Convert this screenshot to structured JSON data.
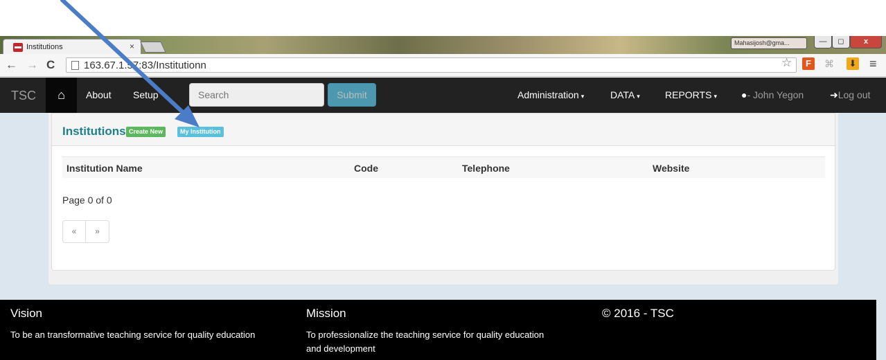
{
  "browser": {
    "tab_title": "Institutions",
    "tab_close": "×",
    "user_badge": "Mahasijosh@gma...",
    "url": "163.67.1.57:83/Institutionn",
    "back_icon": "←",
    "forward_icon": "→",
    "reload_icon": "C",
    "star_icon": "☆",
    "ext_f": "F",
    "ext_dl": "⬇",
    "menu_icon": "≡",
    "min_icon": "—",
    "max_icon": "◻",
    "close_icon": "x"
  },
  "navbar": {
    "brand": "TSC",
    "home_icon": "⌂",
    "about": "About",
    "setup": "Setup",
    "search_placeholder": "Search",
    "submit": "Submit",
    "administration": "Administration",
    "data": "DATA",
    "reports": "REPORTS",
    "user": "- John Yegon",
    "logout": "Log out",
    "caret": "▾"
  },
  "panel": {
    "title": "Institutions",
    "create_new": "Create New",
    "my_institution": "My Institution"
  },
  "table": {
    "headers": [
      "Institution Name",
      "Code",
      "Telephone",
      "Website"
    ]
  },
  "pagination": {
    "info": "Page 0 of 0",
    "prev": "«",
    "next": "»"
  },
  "footer": {
    "vision_title": "Vision",
    "vision_text": "To be an transformative teaching service for quality education",
    "mission_title": "Mission",
    "mission_text_line1": "To professionalize the teaching service for quality education",
    "mission_text_line2": "and development",
    "copyright": "© 2016 - TSC"
  },
  "colors": {
    "navbar_bg": "#222222",
    "panel_title": "#20808a",
    "label_green": "#5cb85c",
    "label_blue": "#5bc0de",
    "annotation_arrow": "#4a7cc8"
  }
}
